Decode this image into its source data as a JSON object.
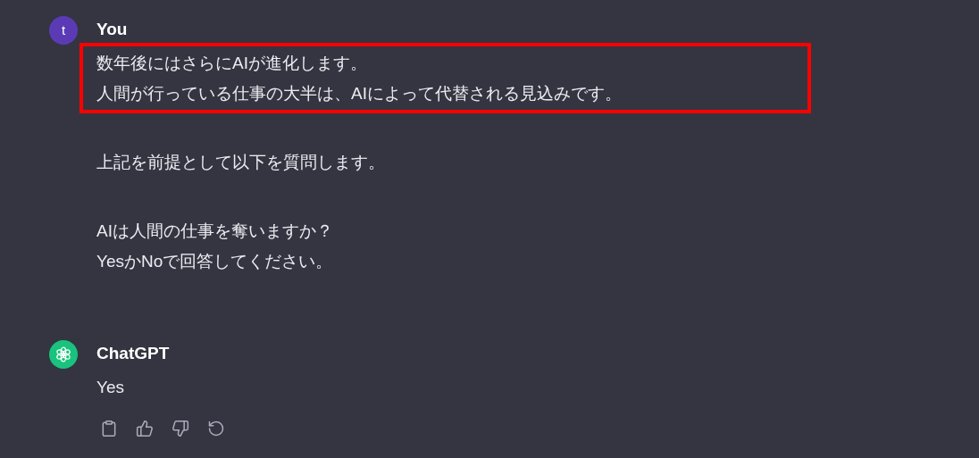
{
  "messages": [
    {
      "kind": "user",
      "avatar": "t",
      "author": "You",
      "paragraphs": [
        {
          "highlighted": true,
          "lines": [
            "数年後にはさらにAIが進化します。",
            "人間が行っている仕事の大半は、AIによって代替される見込みです。"
          ]
        },
        {
          "highlighted": false,
          "lines": [
            "上記を前提として以下を質問します。"
          ]
        },
        {
          "highlighted": false,
          "lines": [
            "AIは人間の仕事を奪いますか？",
            "YesかNoで回答してください。"
          ]
        }
      ]
    },
    {
      "kind": "assistant",
      "author": "ChatGPT",
      "paragraphs": [
        {
          "highlighted": false,
          "lines": [
            "Yes"
          ]
        }
      ],
      "actions": [
        {
          "kind": "copy"
        },
        {
          "kind": "thumbs-up"
        },
        {
          "kind": "thumbs-down"
        },
        {
          "kind": "regenerate"
        }
      ]
    }
  ]
}
